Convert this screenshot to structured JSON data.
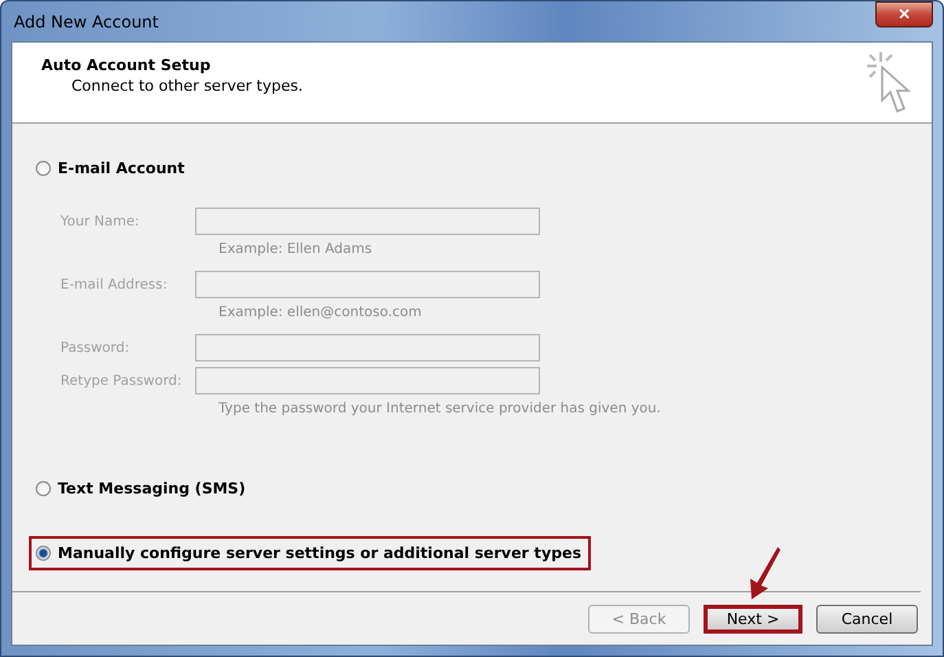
{
  "window": {
    "title": "Add New Account",
    "close": "✕"
  },
  "header": {
    "title": "Auto Account Setup",
    "subtitle": "Connect to other server types."
  },
  "options": [
    {
      "kind": "radio",
      "label": "E-mail Account",
      "selected": false,
      "highlighted": false,
      "fields": [
        {
          "label": "Your Name:",
          "hint": "Example: Ellen Adams",
          "disabled": true
        },
        {
          "label": "E-mail Address:",
          "hint": "Example: ellen@contoso.com",
          "disabled": true
        },
        {
          "label": "Password:",
          "disabled": true
        },
        {
          "label": "Retype Password:",
          "hint": "Type the password your Internet service provider has given you.",
          "disabled": true
        }
      ]
    },
    {
      "kind": "radio",
      "label": "Text Messaging (SMS)",
      "selected": false,
      "highlighted": false
    },
    {
      "kind": "radio",
      "label": "Manually configure server settings or additional server types",
      "selected": true,
      "highlighted": true
    }
  ],
  "buttons": [
    {
      "label": "< Back",
      "disabled": true,
      "highlighted": false
    },
    {
      "label": "Next >",
      "disabled": false,
      "highlighted": true
    },
    {
      "label": "Cancel",
      "disabled": false,
      "highlighted": false
    }
  ]
}
